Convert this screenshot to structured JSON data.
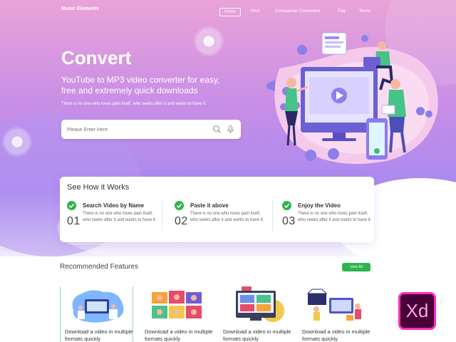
{
  "header": {
    "logo": "Music Elements",
    "nav": [
      {
        "label": "Home",
        "active": true
      },
      {
        "label": "Post",
        "active": false
      },
      {
        "label": "Comparison Converters",
        "active": false
      },
      {
        "label": "Faq",
        "active": false
      },
      {
        "label": "Terms",
        "active": false
      }
    ]
  },
  "hero": {
    "title": "Convert",
    "subtitle": "YouTube to MP3 video converter for easy, free and extremely quick downloads",
    "tagline": "There is no one who loves pain itself, who seeks after it and wants to have it.",
    "search_placeholder": "Please Enter Here",
    "search_icon": "search-icon",
    "mic_icon": "microphone-icon"
  },
  "how_it_works": {
    "title": "See How it Works",
    "steps": [
      {
        "number": "01",
        "title": "Search Video by Name",
        "desc": "There is no one who loves pain itself, who seeks after it and wants to have it."
      },
      {
        "number": "02",
        "title": "Paste it above",
        "desc": "There is no one who loves pain itself, who seeks after it and wants to have it."
      },
      {
        "number": "03",
        "title": "Enjoy the Video",
        "desc": "There is no one who loves pain itself, who seeks after it and wants to have it."
      }
    ]
  },
  "recommended": {
    "title": "Recommended Features",
    "view_all": "View All",
    "cards": [
      {
        "text": "Download a video in multiple formats quickly"
      },
      {
        "text": "Download a video in multiple formats quickly"
      },
      {
        "text": "Download a video in multiple formats quickly"
      },
      {
        "text": "Download a video in multiple formats quickly"
      }
    ]
  },
  "badge": {
    "label": "Xd"
  },
  "colors": {
    "accent_green": "#2fb34c",
    "hero_pink": "#e9a3d8",
    "hero_purple": "#a78af0",
    "xd_bg": "#470137",
    "xd_border": "#ff2bc2"
  }
}
